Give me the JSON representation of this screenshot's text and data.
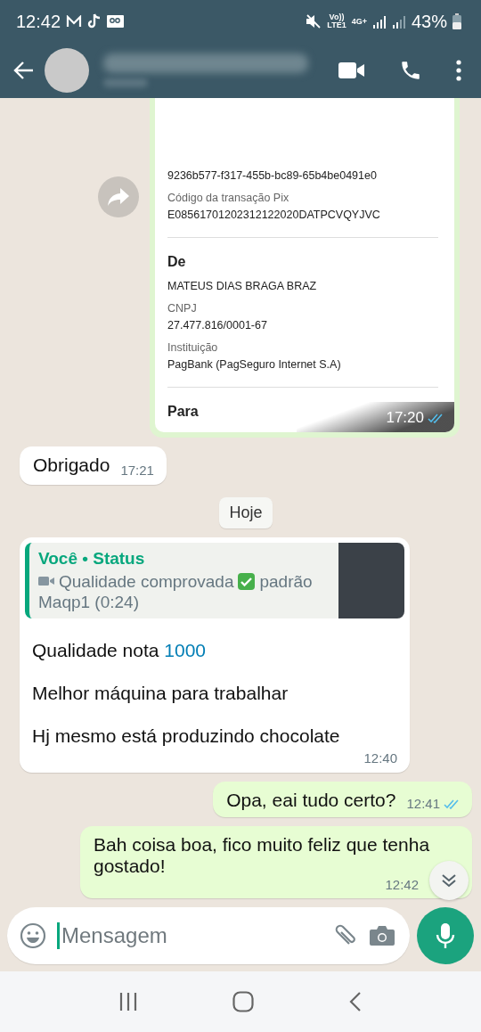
{
  "status_bar": {
    "time": "12:42",
    "network_top": "Vo))",
    "network_bottom": "LTE1",
    "data_type": "4G+",
    "battery": "43%"
  },
  "messages": [
    {
      "kind": "receipt",
      "fields": [
        {
          "kind": "value",
          "text": "9236b577-f317-455b-bc89-65b4be0491e0"
        },
        {
          "kind": "label",
          "text": "Código da transação Pix"
        },
        {
          "kind": "value",
          "text": "E08561701202312122020DATPCVQYJVC"
        },
        {
          "kind": "divider"
        },
        {
          "kind": "heading",
          "text": "De"
        },
        {
          "kind": "value",
          "text": "MATEUS DIAS BRAGA BRAZ"
        },
        {
          "kind": "label",
          "text": "CNPJ"
        },
        {
          "kind": "value",
          "text": "27.477.816/0001-67"
        },
        {
          "kind": "label",
          "text": "Instituição"
        },
        {
          "kind": "value",
          "text": "PagBank (PagSeguro Internet S.A)"
        },
        {
          "kind": "divider"
        },
        {
          "kind": "heading",
          "text": "Para"
        }
      ],
      "time": "17:20",
      "read": true
    },
    {
      "kind": "incoming",
      "text": "Obrigado",
      "time": "17:21"
    },
    {
      "kind": "date",
      "text": "Hoje"
    },
    {
      "kind": "reply",
      "quote": {
        "author": "Você • Status",
        "before": "Qualidade comprovada",
        "after": "padrão",
        "line2": "Maqp1 (0:24)"
      },
      "lines": [
        {
          "text": "Qualidade nota ",
          "link": "1000"
        },
        {
          "text": "Melhor máquina para trabalhar"
        },
        {
          "text": "Hj mesmo está produzindo chocolate"
        }
      ],
      "time": "12:40"
    },
    {
      "kind": "outgoing",
      "text": "Opa, eai tudo certo?",
      "time": "12:41",
      "read": true
    },
    {
      "kind": "outgoing",
      "text": "Bah coisa boa, fico muito feliz que tenha gostado!",
      "time": "12:42"
    }
  ],
  "composer": {
    "placeholder": "Mensagem"
  }
}
